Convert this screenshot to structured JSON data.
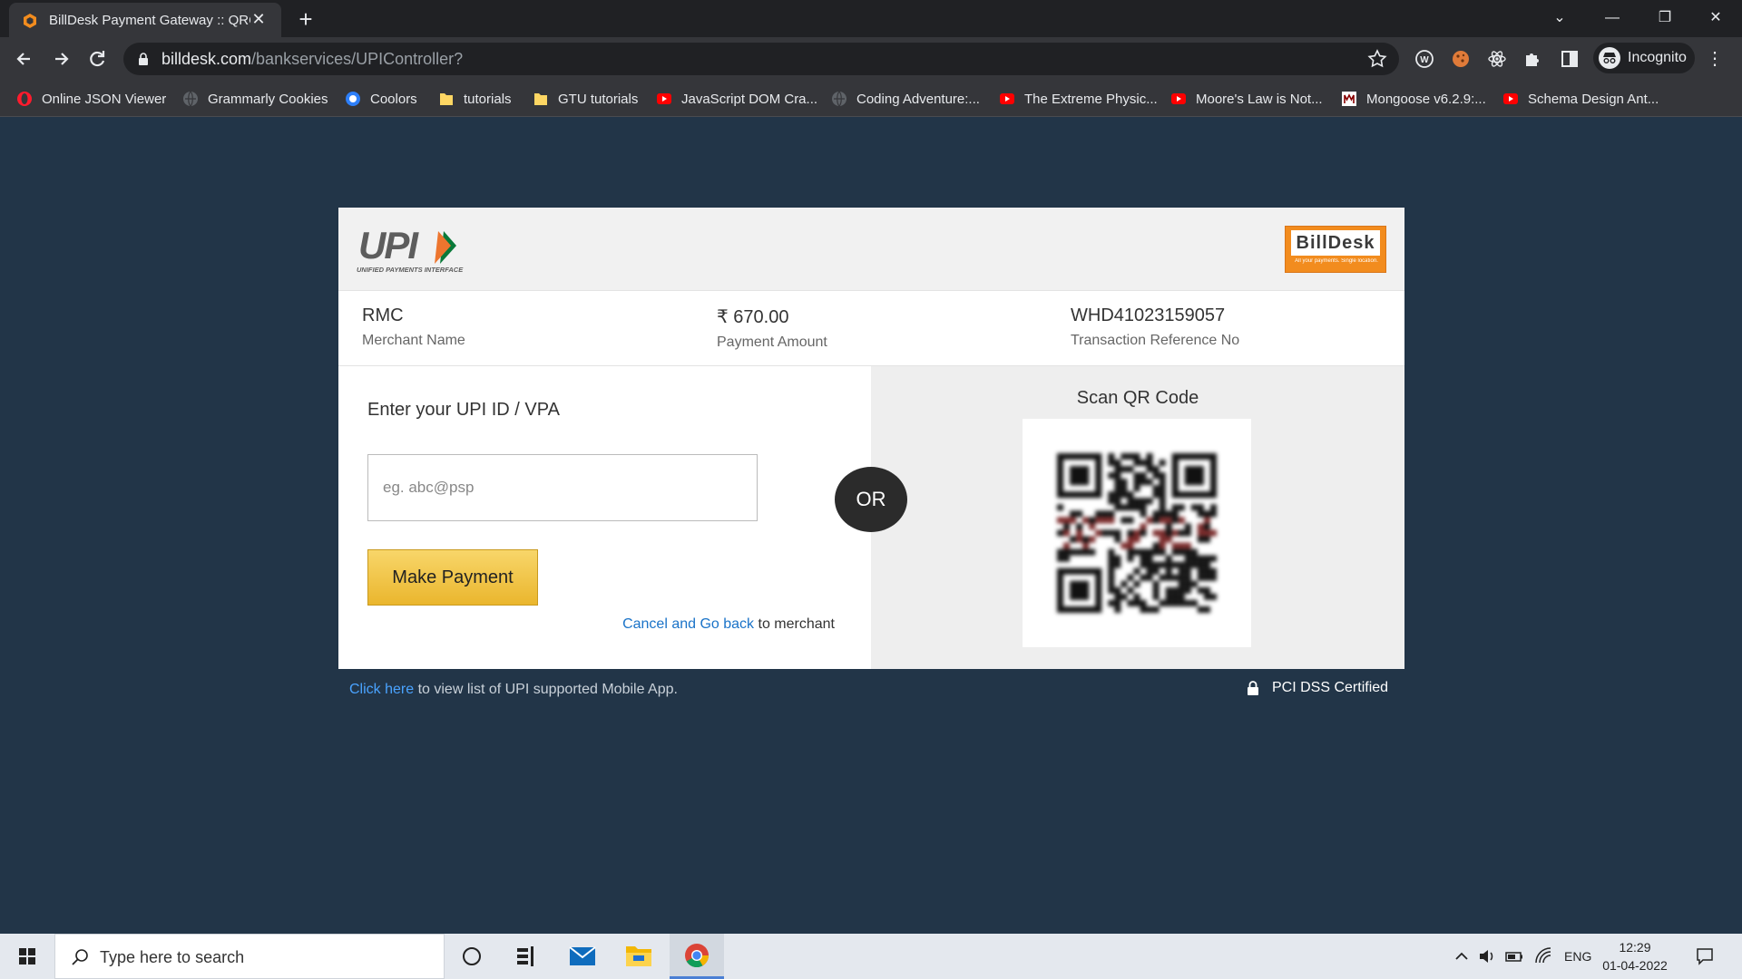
{
  "browser": {
    "tab_title": "BillDesk Payment Gateway :: QRC",
    "url_host": "billdesk.com",
    "url_path": "/bankservices/UPIController?",
    "profile_label": "Incognito",
    "bookmarks": [
      {
        "label": "Online JSON Viewer",
        "icon": "opera-icon"
      },
      {
        "label": "Grammarly Cookies",
        "icon": "globe-icon"
      },
      {
        "label": "Coolors",
        "icon": "coolors-icon"
      },
      {
        "label": "tutorials",
        "icon": "folder-icon"
      },
      {
        "label": "GTU tutorials",
        "icon": "folder-icon"
      },
      {
        "label": "JavaScript DOM Cra...",
        "icon": "youtube-icon"
      },
      {
        "label": "Coding Adventure:...",
        "icon": "globe-icon"
      },
      {
        "label": "The Extreme Physic...",
        "icon": "youtube-icon"
      },
      {
        "label": "Moore's Law is Not...",
        "icon": "youtube-icon"
      },
      {
        "label": "Mongoose v6.2.9:...",
        "icon": "mongoose-icon"
      },
      {
        "label": "Schema Design Ant...",
        "icon": "youtube-icon"
      }
    ]
  },
  "payment": {
    "upi_logo_text": "UPI",
    "upi_logo_sub": "UNIFIED PAYMENTS INTERFACE",
    "billdesk_logo_text": "BillDesk",
    "billdesk_tagline": "All your payments. Single location.",
    "merchant_name": "RMC",
    "merchant_label": "Merchant Name",
    "amount": "₹ 670.00",
    "amount_label": "Payment Amount",
    "txn_ref": "WHD41023159057",
    "txn_label": "Transaction Reference No",
    "vpa_title": "Enter your UPI ID / VPA",
    "vpa_placeholder": "eg. abc@psp",
    "vpa_value": "",
    "pay_button": "Make Payment",
    "cancel_link": "Cancel and Go back",
    "cancel_suffix": " to merchant",
    "or_label": "OR",
    "qr_title": "Scan QR Code"
  },
  "footer": {
    "click_here": "Click here",
    "app_list_text": " to view list of UPI supported Mobile App.",
    "pci_label": "PCI DSS Certified"
  },
  "taskbar": {
    "search_placeholder": "Type here to search",
    "language": "ENG",
    "time": "12:29",
    "date": "01-04-2022"
  },
  "colors": {
    "page_bg": "#223548",
    "button_gold": "#eab62e",
    "link_blue": "#1a73c8",
    "billdesk_orange": "#f28c1e"
  }
}
